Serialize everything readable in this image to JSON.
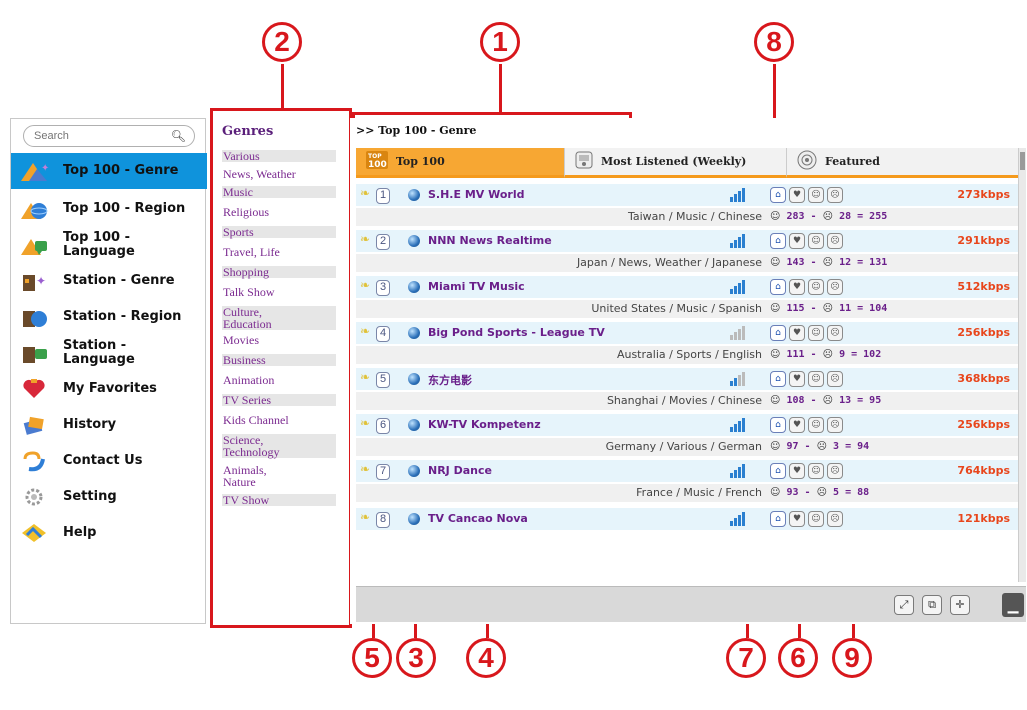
{
  "sidebar": {
    "search_placeholder": "Search",
    "items": [
      {
        "label": "Top 100 - Genre",
        "icon": "top100-genre-icon"
      },
      {
        "label": "Top 100 - Region",
        "icon": "top100-region-icon"
      },
      {
        "label": "Top 100 -\nLanguage",
        "icon": "top100-language-icon"
      },
      {
        "label": "Station - Genre",
        "icon": "station-genre-icon"
      },
      {
        "label": "Station - Region",
        "icon": "station-region-icon"
      },
      {
        "label": "Station -\nLanguage",
        "icon": "station-language-icon"
      },
      {
        "label": "My Favorites",
        "icon": "heart-icon"
      },
      {
        "label": "History",
        "icon": "history-icon"
      },
      {
        "label": "Contact Us",
        "icon": "contact-icon"
      },
      {
        "label": "Setting",
        "icon": "gear-icon"
      },
      {
        "label": "Help",
        "icon": "help-icon"
      }
    ]
  },
  "genres": {
    "title": "Genres",
    "items": [
      "Various",
      "News, Weather",
      "Music",
      "Religious",
      "Sports",
      "Travel, Life",
      "Shopping",
      "Talk Show",
      "Culture,\nEducation",
      "Movies",
      "Business",
      "Animation",
      "TV Series",
      "Kids Channel",
      "Science,\nTechnology",
      "Animals,\nNature",
      "TV Show"
    ]
  },
  "main": {
    "breadcrumb": ">> Top 100 - Genre",
    "tabs": [
      {
        "label": "Top 100",
        "badge": "TOP 100"
      },
      {
        "label": "Most Listened (Weekly)"
      },
      {
        "label": "Featured"
      }
    ],
    "stations": [
      {
        "rank": "1",
        "name": "S.H.E MV World",
        "kbps": "273kbps",
        "meta": "Taiwan / Music / Chinese",
        "up": "283",
        "down": "28",
        "score": "255"
      },
      {
        "rank": "2",
        "name": "NNN News Realtime",
        "kbps": "291kbps",
        "meta": "Japan / News, Weather / Japanese",
        "up": "143",
        "down": "12",
        "score": "131"
      },
      {
        "rank": "3",
        "name": "Miami TV Music",
        "kbps": "512kbps",
        "meta": "United States / Music / Spanish",
        "up": "115",
        "down": "11",
        "score": "104"
      },
      {
        "rank": "4",
        "name": "Big Pond Sports - League TV",
        "kbps": "256kbps",
        "meta": "Australia / Sports / English",
        "up": "111",
        "down": "9",
        "score": "102"
      },
      {
        "rank": "5",
        "name": "东方电影",
        "kbps": "368kbps",
        "meta": "Shanghai / Movies / Chinese",
        "up": "108",
        "down": "13",
        "score": "95"
      },
      {
        "rank": "6",
        "name": "KW-TV Kompetenz",
        "kbps": "256kbps",
        "meta": "Germany / Various / German",
        "up": "97",
        "down": "3",
        "score": "94"
      },
      {
        "rank": "7",
        "name": "NRJ Dance",
        "kbps": "764kbps",
        "meta": "France / Music / French",
        "up": "93",
        "down": "5",
        "score": "88"
      },
      {
        "rank": "8",
        "name": "TV Cancao Nova",
        "kbps": "121kbps"
      }
    ]
  },
  "callouts": [
    "1",
    "2",
    "3",
    "4",
    "5",
    "6",
    "7",
    "8",
    "9"
  ],
  "colors": {
    "accent": "#0f93dc",
    "callout": "#d8171c",
    "tab_active": "#f7a733",
    "station_name": "#6a1f8a",
    "kbps": "#e8461c"
  }
}
